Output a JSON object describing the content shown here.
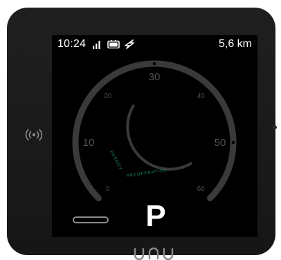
{
  "status_bar": {
    "time": "10:24",
    "distance": "5,6 km",
    "icons": [
      "signal-bars-icon",
      "battery-icon",
      "charging-bolt-icon"
    ]
  },
  "speedometer": {
    "scale_labels": [
      {
        "value": "0"
      },
      {
        "value": "10"
      },
      {
        "value": "20"
      },
      {
        "value": "30"
      },
      {
        "value": "40"
      },
      {
        "value": "50"
      },
      {
        "value": "60"
      }
    ],
    "max_speed": 60,
    "current_speed": 0,
    "energy_recuperation_text_1": "ENERGY",
    "energy_recuperation_text_2": "RECUPERATION",
    "colors": {
      "track": "#3a3a3a",
      "labels": "#4c4c4c",
      "label_major": "#555555",
      "recuperation": "#1e8f5a"
    }
  },
  "gear": {
    "label": "P"
  },
  "device": {
    "brand": "unu",
    "icons": [
      "nfc-icon",
      "side-indicator-dot"
    ]
  }
}
